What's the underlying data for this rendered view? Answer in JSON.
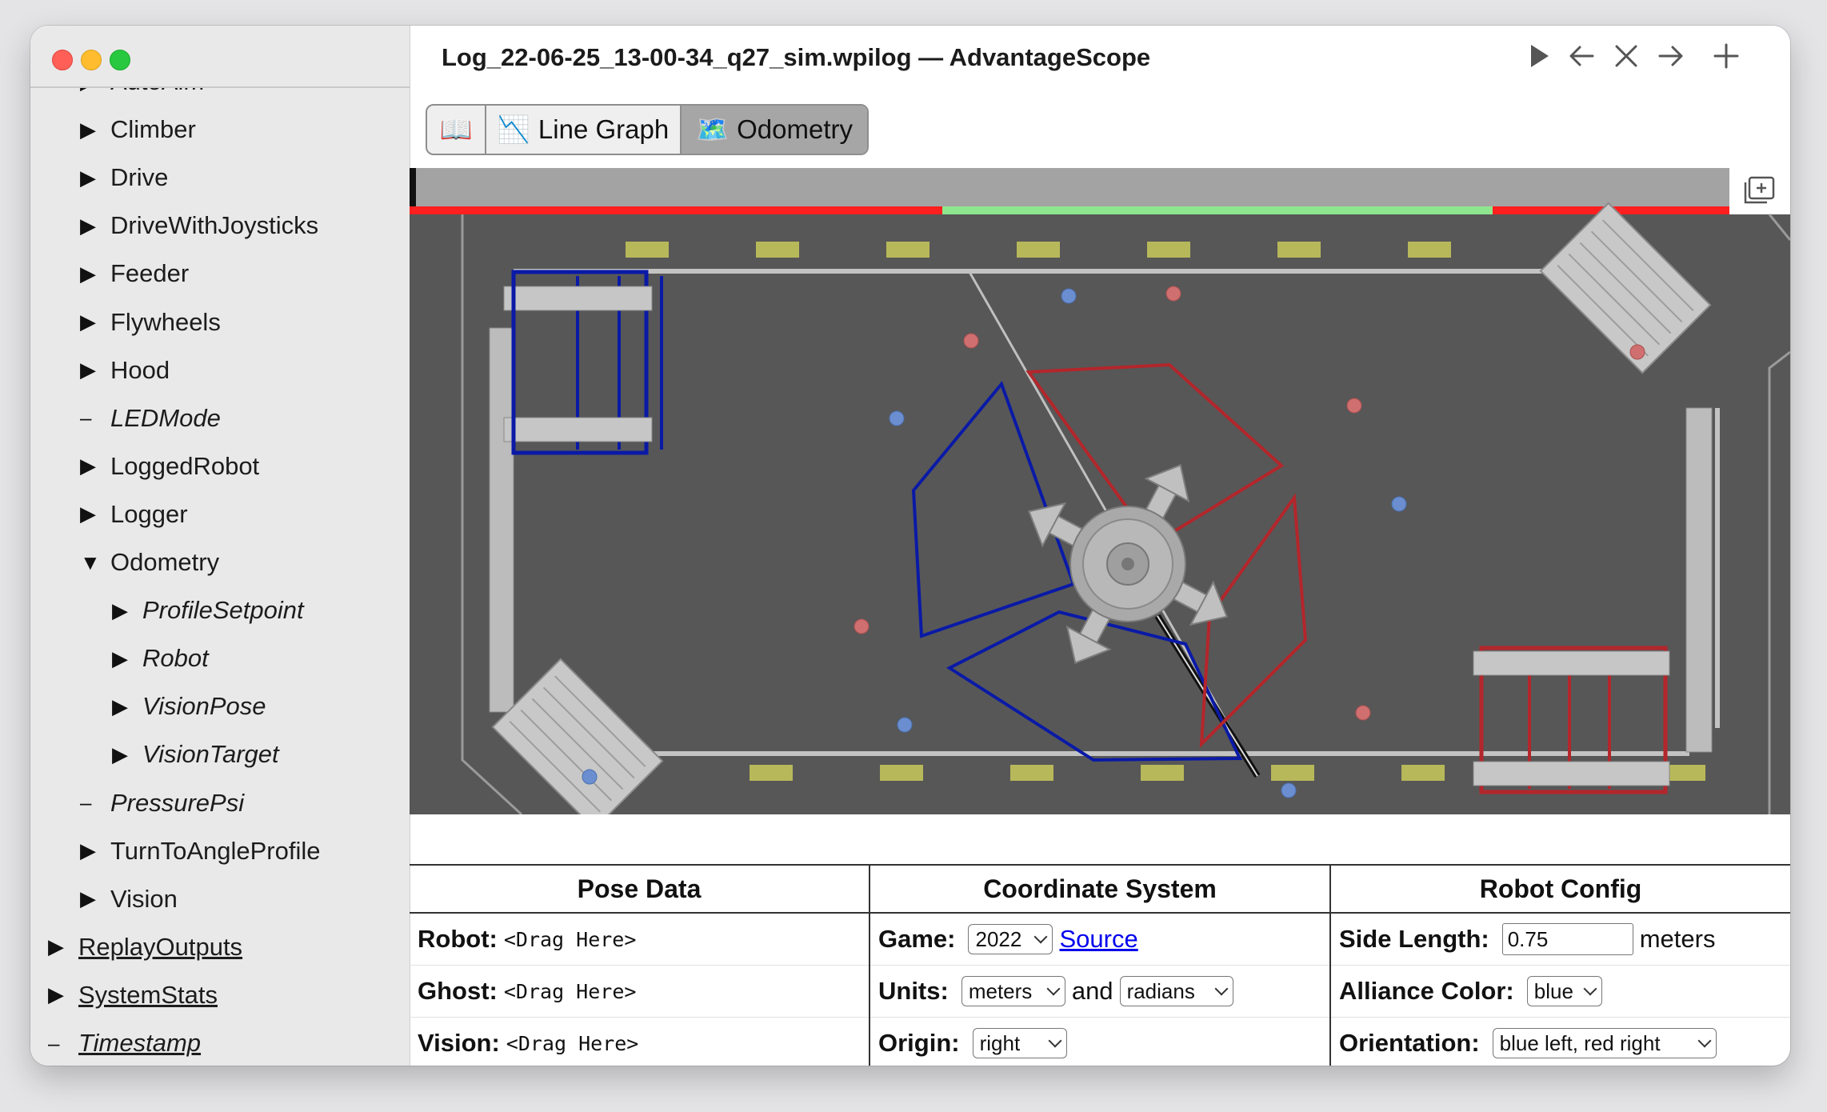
{
  "window": {
    "title": "Log_22-06-25_13-00-34_q27_sim.wpilog — AdvantageScope"
  },
  "sidebar": {
    "items": [
      {
        "label": "AutoAim",
        "marker": "▶",
        "style": "normal",
        "indent": 0
      },
      {
        "label": "Climber",
        "marker": "▶",
        "style": "normal",
        "indent": 0
      },
      {
        "label": "Drive",
        "marker": "▶",
        "style": "normal",
        "indent": 0
      },
      {
        "label": "DriveWithJoysticks",
        "marker": "▶",
        "style": "normal",
        "indent": 0
      },
      {
        "label": "Feeder",
        "marker": "▶",
        "style": "normal",
        "indent": 0
      },
      {
        "label": "Flywheels",
        "marker": "▶",
        "style": "normal",
        "indent": 0
      },
      {
        "label": "Hood",
        "marker": "▶",
        "style": "normal",
        "indent": 0
      },
      {
        "label": "LEDMode",
        "marker": "–",
        "style": "italic",
        "indent": 0
      },
      {
        "label": "LoggedRobot",
        "marker": "▶",
        "style": "normal",
        "indent": 0
      },
      {
        "label": "Logger",
        "marker": "▶",
        "style": "normal",
        "indent": 0
      },
      {
        "label": "Odometry",
        "marker": "▼",
        "style": "normal",
        "indent": 0
      },
      {
        "label": "ProfileSetpoint",
        "marker": "▶",
        "style": "italic",
        "indent": 1
      },
      {
        "label": "Robot",
        "marker": "▶",
        "style": "italic",
        "indent": 1
      },
      {
        "label": "VisionPose",
        "marker": "▶",
        "style": "italic",
        "indent": 1
      },
      {
        "label": "VisionTarget",
        "marker": "▶",
        "style": "italic",
        "indent": 1
      },
      {
        "label": "PressurePsi",
        "marker": "–",
        "style": "italic",
        "indent": 0
      },
      {
        "label": "TurnToAngleProfile",
        "marker": "▶",
        "style": "normal",
        "indent": 0
      },
      {
        "label": "Vision",
        "marker": "▶",
        "style": "normal",
        "indent": 0
      },
      {
        "label": "ReplayOutputs",
        "marker": "▶",
        "style": "underline",
        "indent": -1
      },
      {
        "label": "SystemStats",
        "marker": "▶",
        "style": "underline",
        "indent": -1
      },
      {
        "label": "Timestamp",
        "marker": "–",
        "style": "italic underline",
        "indent": -1
      }
    ]
  },
  "tabs": [
    {
      "label": "",
      "icon": "📖",
      "name": "tab-docs",
      "active": false
    },
    {
      "label": "Line Graph",
      "icon": "📉",
      "name": "tab-line-graph",
      "active": false
    },
    {
      "label": "Odometry",
      "icon": "🗺️",
      "name": "tab-odometry",
      "active": true
    }
  ],
  "controls": {
    "pose": {
      "header": "Pose Data",
      "robot_label": "Robot:",
      "robot_value": "<Drag Here>",
      "ghost_label": "Ghost:",
      "ghost_value": "<Drag Here>",
      "vision_label": "Vision:",
      "vision_value": "<Drag Here>"
    },
    "coords": {
      "header": "Coordinate System",
      "game_label": "Game:",
      "game_value": "2022",
      "source_link": "Source",
      "units_label": "Units:",
      "units_distance": "meters",
      "units_and": "and",
      "units_angle": "radians",
      "origin_label": "Origin:",
      "origin_value": "right"
    },
    "robot": {
      "header": "Robot Config",
      "side_label": "Side Length:",
      "side_value": "0.75",
      "side_unit": "meters",
      "alliance_label": "Alliance Color:",
      "alliance_value": "blue",
      "orientation_label": "Orientation:",
      "orientation_value": "blue left, red right"
    }
  },
  "colors": {
    "field": "#575757",
    "blue_alliance": "#0a1aa6",
    "red_alliance": "#b3262b",
    "timeline_red": "#ff1f1f",
    "timeline_green": "#8ee68e"
  }
}
